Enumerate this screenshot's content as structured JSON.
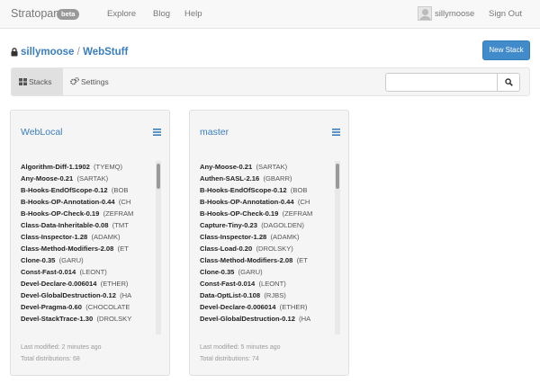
{
  "navbar": {
    "brand": "Stratopan",
    "badge": "beta",
    "links": [
      "Explore",
      "Blog",
      "Help"
    ],
    "username": "sillymoose",
    "sign_out": "Sign Out"
  },
  "breadcrumb": {
    "owner": "sillymoose",
    "separator": "/",
    "repo": "WebStuff"
  },
  "new_stack_label": "New Stack",
  "tabs": [
    {
      "label": "Stacks",
      "icon": "grid-icon",
      "active": true
    },
    {
      "label": "Settings",
      "icon": "gears-icon",
      "active": false
    }
  ],
  "search": {
    "placeholder": "",
    "value": ""
  },
  "stacks": [
    {
      "title": "WebLocal",
      "distributions": [
        {
          "name": "Algorithm-Diff-1.1902",
          "author": "(TYEMQ)"
        },
        {
          "name": "Any-Moose-0.21",
          "author": "(SARTAK)"
        },
        {
          "name": "B-Hooks-EndOfScope-0.12",
          "author": "(BOB"
        },
        {
          "name": "B-Hooks-OP-Annotation-0.44",
          "author": "(CH"
        },
        {
          "name": "B-Hooks-OP-Check-0.19",
          "author": "(ZEFRAM"
        },
        {
          "name": "Class-Data-Inheritable-0.08",
          "author": "(TMT"
        },
        {
          "name": "Class-Inspector-1.28",
          "author": "(ADAMK)"
        },
        {
          "name": "Class-Method-Modifiers-2.08",
          "author": "(ET"
        },
        {
          "name": "Clone-0.35",
          "author": "(GARU)"
        },
        {
          "name": "Const-Fast-0.014",
          "author": "(LEONT)"
        },
        {
          "name": "Devel-Declare-0.006014",
          "author": "(ETHER)"
        },
        {
          "name": "Devel-GlobalDestruction-0.12",
          "author": "(HA"
        },
        {
          "name": "Devel-Pragma-0.60",
          "author": "(CHOCOLATE"
        },
        {
          "name": "Devel-StackTrace-1.30",
          "author": "(DROLSKY"
        }
      ],
      "last_modified": "Last modified: 2 minutes ago",
      "total": "Total distributions: 68"
    },
    {
      "title": "master",
      "distributions": [
        {
          "name": "Any-Moose-0.21",
          "author": "(SARTAK)"
        },
        {
          "name": "Authen-SASL-2.16",
          "author": "(GBARR)"
        },
        {
          "name": "B-Hooks-EndOfScope-0.12",
          "author": "(BOB"
        },
        {
          "name": "B-Hooks-OP-Annotation-0.44",
          "author": "(CH"
        },
        {
          "name": "B-Hooks-OP-Check-0.19",
          "author": "(ZEFRAM"
        },
        {
          "name": "Capture-Tiny-0.23",
          "author": "(DAGOLDEN)"
        },
        {
          "name": "Class-Inspector-1.28",
          "author": "(ADAMK)"
        },
        {
          "name": "Class-Load-0.20",
          "author": "(DROLSKY)"
        },
        {
          "name": "Class-Method-Modifiers-2.08",
          "author": "(ET"
        },
        {
          "name": "Clone-0.35",
          "author": "(GARU)"
        },
        {
          "name": "Const-Fast-0.014",
          "author": "(LEONT)"
        },
        {
          "name": "Data-OptList-0.108",
          "author": "(RJBS)"
        },
        {
          "name": "Devel-Declare-0.006014",
          "author": "(ETHER)"
        },
        {
          "name": "Devel-GlobalDestruction-0.12",
          "author": "(HA"
        }
      ],
      "last_modified": "Last modified: 5 minutes ago",
      "total": "Total distributions: 74"
    }
  ],
  "colors": {
    "link": "#3a7ebf",
    "primary_button": "#428bca",
    "navbar_bg": "#f8f8f8",
    "card_bg": "#f5f5f5"
  }
}
